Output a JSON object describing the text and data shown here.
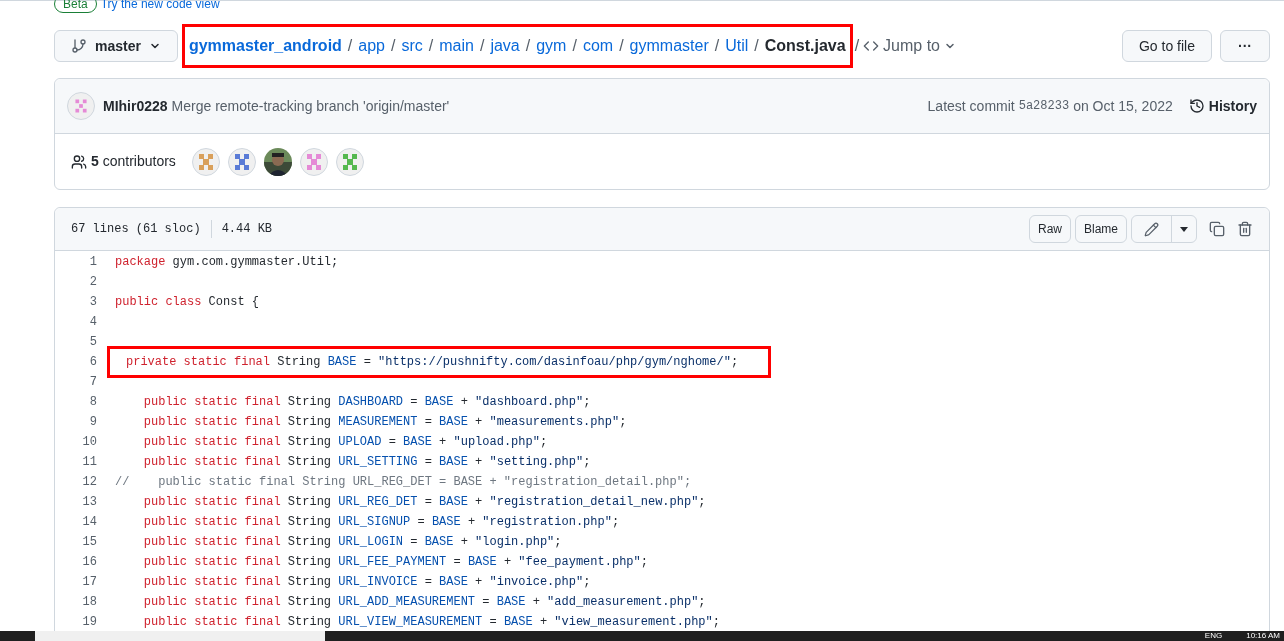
{
  "banner": {
    "badge": "Beta",
    "link": "Try the new code view"
  },
  "branch": {
    "name": "master"
  },
  "breadcrumb": {
    "highlighted": true,
    "segments": [
      {
        "text": "gymmaster_android",
        "kind": "repo"
      },
      {
        "text": "app",
        "kind": "dir"
      },
      {
        "text": "src",
        "kind": "dir"
      },
      {
        "text": "main",
        "kind": "dir"
      },
      {
        "text": "java",
        "kind": "dir"
      },
      {
        "text": "gym",
        "kind": "dir"
      },
      {
        "text": "com",
        "kind": "dir"
      },
      {
        "text": "gymmaster",
        "kind": "dir"
      },
      {
        "text": "Util",
        "kind": "dir"
      },
      {
        "text": "Const.java",
        "kind": "file"
      }
    ],
    "separator": "/"
  },
  "jump_to": "Jump to",
  "go_to_file": "Go to file",
  "more": "···",
  "commit": {
    "author": "MIhir0228",
    "message": "Merge remote-tracking branch 'origin/master'",
    "latest_label": "Latest commit",
    "sha": "5a28233",
    "date": "on Oct 15, 2022",
    "history": "History"
  },
  "contributors": {
    "count": "5",
    "label": "contributors",
    "avatars": [
      {
        "kind": "identicon",
        "color": "#d9a05b"
      },
      {
        "kind": "identicon",
        "color": "#5a7bd6"
      },
      {
        "kind": "picture"
      },
      {
        "kind": "identicon",
        "color": "#e58ad6"
      },
      {
        "kind": "identicon",
        "color": "#55b84e"
      }
    ]
  },
  "file": {
    "lines": "67 lines (61 sloc)",
    "size": "4.44 KB",
    "raw": "Raw",
    "blame": "Blame"
  },
  "code": [
    {
      "n": "1",
      "highlighted": false,
      "tokens": [
        {
          "kind": "keyword",
          "text": "package"
        },
        {
          "kind": "plain",
          "text": " gym.com.gymmaster.Util;"
        }
      ]
    },
    {
      "n": "2",
      "highlighted": false
    },
    {
      "n": "3",
      "highlighted": false,
      "tokens": [
        {
          "kind": "keyword",
          "text": "public class"
        },
        {
          "kind": "plain",
          "text": " Const {"
        }
      ]
    },
    {
      "n": "4",
      "highlighted": false
    },
    {
      "n": "5",
      "highlighted": false
    },
    {
      "n": "6",
      "highlighted": true,
      "tokens": [
        {
          "kind": "keyword",
          "text": "private static final"
        },
        {
          "kind": "plain",
          "text": " String "
        },
        {
          "kind": "ident",
          "text": "BASE"
        },
        {
          "kind": "plain",
          "text": " = "
        },
        {
          "kind": "string",
          "text": "\"https://pushnifty.com/dasinfoau/php/gym/nghome/\""
        },
        {
          "kind": "plain",
          "text": ";"
        }
      ]
    },
    {
      "n": "7",
      "highlighted": false
    },
    {
      "n": "8",
      "highlighted": false,
      "tokens": [
        {
          "kind": "keyword",
          "text": "    public static final"
        },
        {
          "kind": "plain",
          "text": " String "
        },
        {
          "kind": "ident",
          "text": "DASHBOARD"
        },
        {
          "kind": "plain",
          "text": " = "
        },
        {
          "kind": "ident",
          "text": "BASE"
        },
        {
          "kind": "plain",
          "text": " + "
        },
        {
          "kind": "string",
          "text": "\"dashboard.php\""
        },
        {
          "kind": "plain",
          "text": ";"
        }
      ]
    },
    {
      "n": "9",
      "highlighted": false,
      "tokens": [
        {
          "kind": "keyword",
          "text": "    public static final"
        },
        {
          "kind": "plain",
          "text": " String "
        },
        {
          "kind": "ident",
          "text": "MEASUREMENT"
        },
        {
          "kind": "plain",
          "text": " = "
        },
        {
          "kind": "ident",
          "text": "BASE"
        },
        {
          "kind": "plain",
          "text": " + "
        },
        {
          "kind": "string",
          "text": "\"measurements.php\""
        },
        {
          "kind": "plain",
          "text": ";"
        }
      ]
    },
    {
      "n": "10",
      "highlighted": false,
      "tokens": [
        {
          "kind": "keyword",
          "text": "    public static final"
        },
        {
          "kind": "plain",
          "text": " String "
        },
        {
          "kind": "ident",
          "text": "UPLOAD"
        },
        {
          "kind": "plain",
          "text": " = "
        },
        {
          "kind": "ident",
          "text": "BASE"
        },
        {
          "kind": "plain",
          "text": " + "
        },
        {
          "kind": "string",
          "text": "\"upload.php\""
        },
        {
          "kind": "plain",
          "text": ";"
        }
      ]
    },
    {
      "n": "11",
      "highlighted": false,
      "tokens": [
        {
          "kind": "keyword",
          "text": "    public static final"
        },
        {
          "kind": "plain",
          "text": " String "
        },
        {
          "kind": "ident",
          "text": "URL_SETTING"
        },
        {
          "kind": "plain",
          "text": " = "
        },
        {
          "kind": "ident",
          "text": "BASE"
        },
        {
          "kind": "plain",
          "text": " + "
        },
        {
          "kind": "string",
          "text": "\"setting.php\""
        },
        {
          "kind": "plain",
          "text": ";"
        }
      ]
    },
    {
      "n": "12",
      "highlighted": false,
      "tokens": [
        {
          "kind": "comment",
          "text": "//    public static final String URL_REG_DET = BASE + \"registration_detail.php\";"
        }
      ]
    },
    {
      "n": "13",
      "highlighted": false,
      "tokens": [
        {
          "kind": "keyword",
          "text": "    public static final"
        },
        {
          "kind": "plain",
          "text": " String "
        },
        {
          "kind": "ident",
          "text": "URL_REG_DET"
        },
        {
          "kind": "plain",
          "text": " = "
        },
        {
          "kind": "ident",
          "text": "BASE"
        },
        {
          "kind": "plain",
          "text": " + "
        },
        {
          "kind": "string",
          "text": "\"registration_detail_new.php\""
        },
        {
          "kind": "plain",
          "text": ";"
        }
      ]
    },
    {
      "n": "14",
      "highlighted": false,
      "tokens": [
        {
          "kind": "keyword",
          "text": "    public static final"
        },
        {
          "kind": "plain",
          "text": " String "
        },
        {
          "kind": "ident",
          "text": "URL_SIGNUP"
        },
        {
          "kind": "plain",
          "text": " = "
        },
        {
          "kind": "ident",
          "text": "BASE"
        },
        {
          "kind": "plain",
          "text": " + "
        },
        {
          "kind": "string",
          "text": "\"registration.php\""
        },
        {
          "kind": "plain",
          "text": ";"
        }
      ]
    },
    {
      "n": "15",
      "highlighted": false,
      "tokens": [
        {
          "kind": "keyword",
          "text": "    public static final"
        },
        {
          "kind": "plain",
          "text": " String "
        },
        {
          "kind": "ident",
          "text": "URL_LOGIN"
        },
        {
          "kind": "plain",
          "text": " = "
        },
        {
          "kind": "ident",
          "text": "BASE"
        },
        {
          "kind": "plain",
          "text": " + "
        },
        {
          "kind": "string",
          "text": "\"login.php\""
        },
        {
          "kind": "plain",
          "text": ";"
        }
      ]
    },
    {
      "n": "16",
      "highlighted": false,
      "tokens": [
        {
          "kind": "keyword",
          "text": "    public static final"
        },
        {
          "kind": "plain",
          "text": " String "
        },
        {
          "kind": "ident",
          "text": "URL_FEE_PAYMENT"
        },
        {
          "kind": "plain",
          "text": " = "
        },
        {
          "kind": "ident",
          "text": "BASE"
        },
        {
          "kind": "plain",
          "text": " + "
        },
        {
          "kind": "string",
          "text": "\"fee_payment.php\""
        },
        {
          "kind": "plain",
          "text": ";"
        }
      ]
    },
    {
      "n": "17",
      "highlighted": false,
      "tokens": [
        {
          "kind": "keyword",
          "text": "    public static final"
        },
        {
          "kind": "plain",
          "text": " String "
        },
        {
          "kind": "ident",
          "text": "URL_INVOICE"
        },
        {
          "kind": "plain",
          "text": " = "
        },
        {
          "kind": "ident",
          "text": "BASE"
        },
        {
          "kind": "plain",
          "text": " + "
        },
        {
          "kind": "string",
          "text": "\"invoice.php\""
        },
        {
          "kind": "plain",
          "text": ";"
        }
      ]
    },
    {
      "n": "18",
      "highlighted": false,
      "tokens": [
        {
          "kind": "keyword",
          "text": "    public static final"
        },
        {
          "kind": "plain",
          "text": " String "
        },
        {
          "kind": "ident",
          "text": "URL_ADD_MEASUREMENT"
        },
        {
          "kind": "plain",
          "text": " = "
        },
        {
          "kind": "ident",
          "text": "BASE"
        },
        {
          "kind": "plain",
          "text": " + "
        },
        {
          "kind": "string",
          "text": "\"add_measurement.php\""
        },
        {
          "kind": "plain",
          "text": ";"
        }
      ]
    },
    {
      "n": "19",
      "highlighted": false,
      "tokens": [
        {
          "kind": "keyword",
          "text": "    public static final"
        },
        {
          "kind": "plain",
          "text": " String "
        },
        {
          "kind": "ident",
          "text": "URL_VIEW_MEASUREMENT"
        },
        {
          "kind": "plain",
          "text": " = "
        },
        {
          "kind": "ident",
          "text": "BASE"
        },
        {
          "kind": "plain",
          "text": " + "
        },
        {
          "kind": "string",
          "text": "\"view_measurement.php\""
        },
        {
          "kind": "plain",
          "text": ";"
        }
      ]
    }
  ],
  "taskbar": {
    "language": "ENG",
    "time": "10:16 AM"
  }
}
